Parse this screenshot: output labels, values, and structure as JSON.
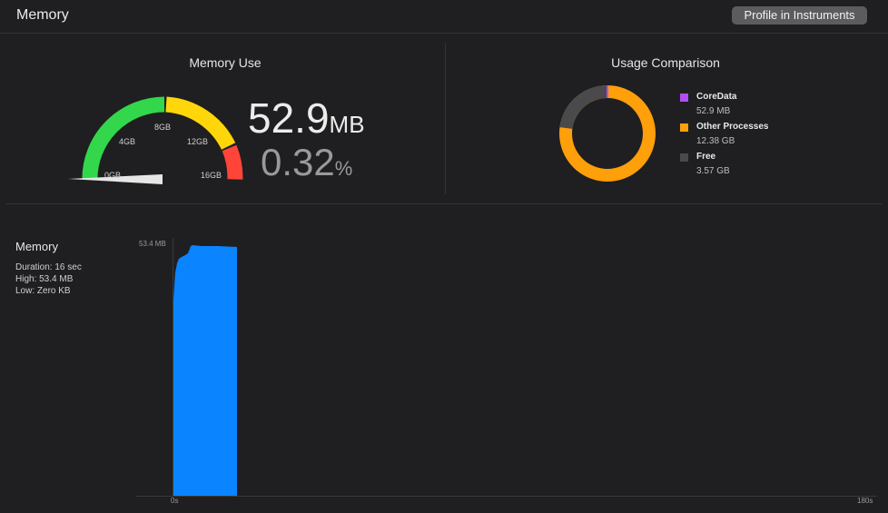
{
  "header": {
    "title": "Memory",
    "profile_button": "Profile in Instruments"
  },
  "memory_use": {
    "title": "Memory Use",
    "gauge_labels": [
      "0GB",
      "4GB",
      "8GB",
      "12GB",
      "16GB"
    ],
    "gauge_fraction": 0.0032,
    "value": "52.9",
    "unit": "MB",
    "percent": "0.32",
    "percent_unit": "%"
  },
  "usage_comparison": {
    "title": "Usage Comparison",
    "legend": [
      {
        "name": "CoreData",
        "value": "52.9 MB",
        "color": "#b54ef0"
      },
      {
        "name": "Other Processes",
        "value": "12.38 GB",
        "color": "#ff9f0a"
      },
      {
        "name": "Free",
        "value": "3.57 GB",
        "color": "#4a4a4c"
      }
    ]
  },
  "graph": {
    "title": "Memory",
    "duration": "Duration: 16 sec",
    "high": "High: 53.4 MB",
    "low": "Low: Zero KB",
    "y_max_label": "53.4 MB",
    "x_start_label": "0s",
    "x_end_label": "180s",
    "fill_color": "#0a84ff"
  },
  "colors": {
    "green": "#32d74b",
    "yellow": "#ffd60a",
    "red": "#ff453a",
    "orange": "#ff9f0a",
    "blue": "#0a84ff"
  }
}
